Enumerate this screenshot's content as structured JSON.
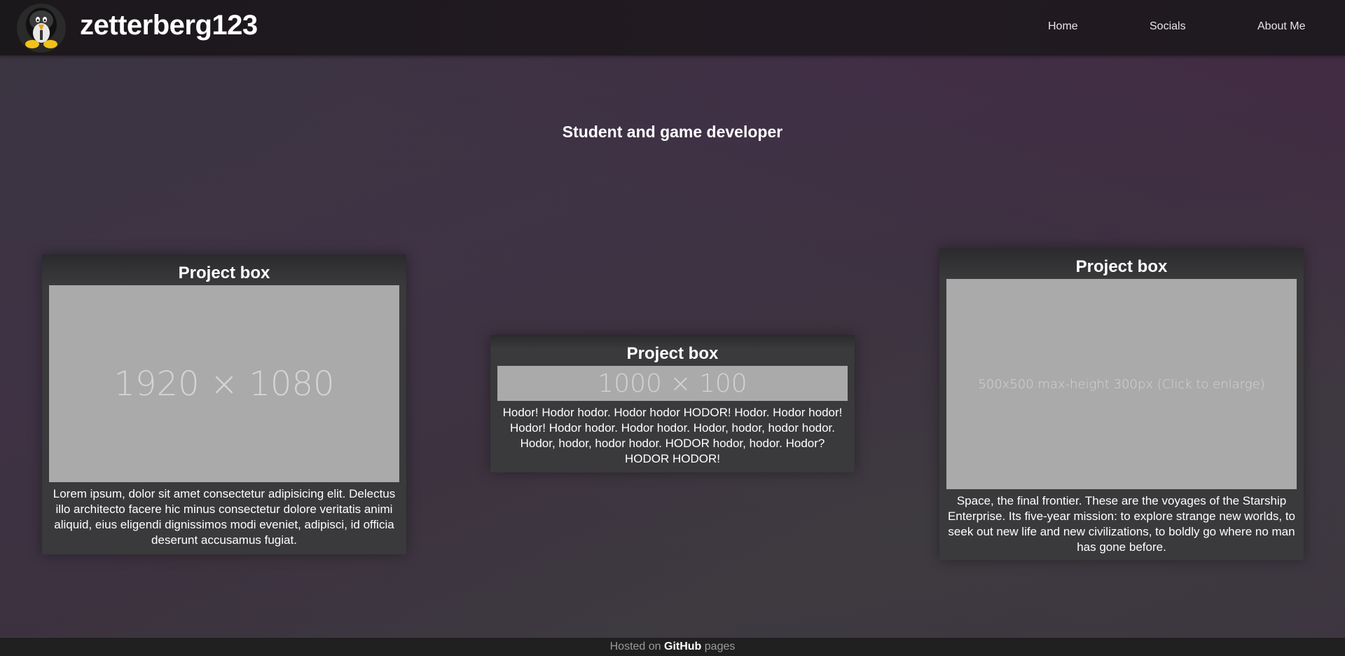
{
  "header": {
    "site_title": "zetterberg123",
    "logo_icon": "tux-penguin-avatar-icon",
    "nav": [
      {
        "label": "Home"
      },
      {
        "label": "Socials"
      },
      {
        "label": "About Me"
      }
    ]
  },
  "main": {
    "tagline": "Student and game developer",
    "projects": [
      {
        "title": "Project box",
        "image_placeholder": "1920 × 1080",
        "description": "Lorem ipsum, dolor sit amet consectetur adipisicing elit. Delectus illo architecto facere hic minus consectetur dolore veritatis animi aliquid, eius eligendi dignissimos modi eveniet, adipisci, id officia deserunt accusamus fugiat."
      },
      {
        "title": "Project box",
        "image_placeholder": "1000 × 100",
        "description": "Hodor! Hodor hodor. Hodor hodor HODOR! Hodor. Hodor hodor! Hodor! Hodor hodor. Hodor hodor. Hodor, hodor, hodor hodor. Hodor, hodor, hodor hodor. HODOR hodor, hodor. Hodor? HODOR HODOR!"
      },
      {
        "title": "Project box",
        "image_placeholder": "500x500 max-height 300px (Click to enlarge)",
        "description": "Space, the final frontier. These are the voyages of the Starship Enterprise. Its five-year mission: to explore strange new worlds, to seek out new life and new civilizations, to boldly go where no man has gone before."
      }
    ]
  },
  "footer": {
    "prefix": "Hosted on ",
    "brand": "GitHub",
    "suffix": " pages"
  },
  "colors": {
    "header_bg": "#1e1a1f",
    "box_bg": "#3a393b",
    "placeholder_bg": "#aaaaaa",
    "footer_bg": "#202020"
  }
}
